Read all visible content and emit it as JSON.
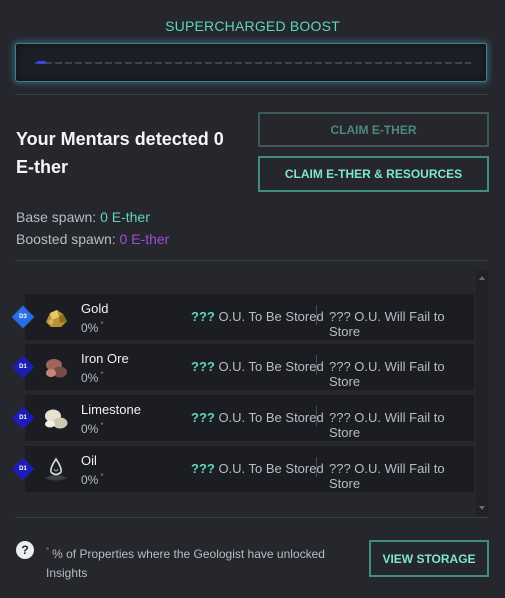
{
  "boost": {
    "title": "SUPERCHARGED BOOST",
    "progress_fraction": 0.02,
    "fill_color": "#3a45e6"
  },
  "summary": {
    "detected_text": "Your Mentars detected 0 E-ther",
    "claim_ether_label": "CLAIM E-THER",
    "claim_all_label": "CLAIM E-THER & RESOURCES",
    "base_label": "Base spawn: ",
    "base_value": "0 E-ther",
    "boosted_label": "Boosted spawn: ",
    "boosted_value": "0 E-ther"
  },
  "resources": [
    {
      "tier": "D3",
      "name": "Gold",
      "percent": "0%",
      "marker": "*",
      "to_store_value": "???",
      "to_store_label": " O.U. To Be Stored",
      "fail_text": "??? O.U. Will Fail to Store",
      "icon": "gold-nugget-icon"
    },
    {
      "tier": "D1",
      "name": "Iron Ore",
      "percent": "0%",
      "marker": "*",
      "to_store_value": "???",
      "to_store_label": " O.U. To Be Stored",
      "fail_text": "??? O.U. Will Fail to Store",
      "icon": "iron-ore-icon"
    },
    {
      "tier": "D1",
      "name": "Limestone",
      "percent": "0%",
      "marker": "*",
      "to_store_value": "???",
      "to_store_label": " O.U. To Be Stored",
      "fail_text": "??? O.U. Will Fail to Store",
      "icon": "limestone-icon"
    },
    {
      "tier": "D1",
      "name": "Oil",
      "percent": "0%",
      "marker": "*",
      "to_store_value": "???",
      "to_store_label": " O.U. To Be Stored",
      "fail_text": "??? O.U. Will Fail to Store",
      "icon": "oil-icon"
    }
  ],
  "footer": {
    "help_glyph": "?",
    "marker": "*",
    "note": "% of Properties where the Geologist have unlocked Insights",
    "view_storage_label": "VIEW STORAGE"
  },
  "colors": {
    "accent": "#5fd6bb",
    "boost_purple": "#9f4fd8",
    "marker_red": "#e06070"
  }
}
